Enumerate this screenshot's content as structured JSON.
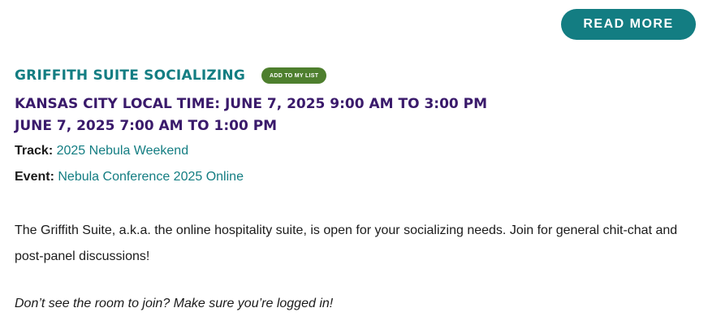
{
  "read_more_label": "READ MORE",
  "event": {
    "title": "Griffith Suite Socializing",
    "add_to_list_label": "ADD TO MY LIST",
    "local_time": "Kansas City Local Time: June 7, 2025 9:00 am to 3:00 pm",
    "user_time": "June 7, 2025 7:00 am to 1:00 pm",
    "track_label": "Track:",
    "track_value": "2025 Nebula Weekend",
    "event_label": "Event:",
    "event_value": "Nebula Conference 2025 Online",
    "description": "The Griffith Suite, a.k.a. the online hospitality suite, is open for your socializing needs. Join for general chit-chat and post-panel discussions!",
    "note": "Don’t see the room to join? Make sure you’re logged in!"
  },
  "colors": {
    "teal": "#137d82",
    "purple": "#3a1a6b",
    "green": "#4e7f2e"
  }
}
